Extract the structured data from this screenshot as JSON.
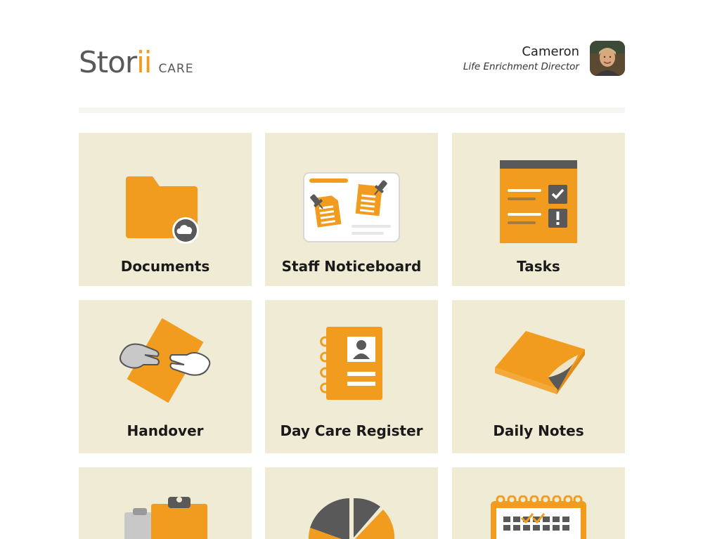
{
  "brand": {
    "logo_word": "Stor",
    "logo_i": "ii",
    "logo_sub": "CARE"
  },
  "user": {
    "name": "Cameron",
    "role": "Life Enrichment Director"
  },
  "colors": {
    "accent": "#f29c1f",
    "tile_bg": "#efebd5",
    "dark_gray": "#555555",
    "light_gray": "#c8c8c8"
  },
  "tiles": [
    {
      "label": "Documents",
      "icon": "folder-cloud-icon"
    },
    {
      "label": "Staff Noticeboard",
      "icon": "noticeboard-icon"
    },
    {
      "label": "Tasks",
      "icon": "task-list-icon"
    },
    {
      "label": "Handover",
      "icon": "handover-icon"
    },
    {
      "label": "Day Care Register",
      "icon": "register-book-icon"
    },
    {
      "label": "Daily Notes",
      "icon": "notepad-icon"
    },
    {
      "label": "",
      "icon": "clipboards-icon"
    },
    {
      "label": "",
      "icon": "pie-chart-icon"
    },
    {
      "label": "",
      "icon": "calendar-icon"
    }
  ]
}
